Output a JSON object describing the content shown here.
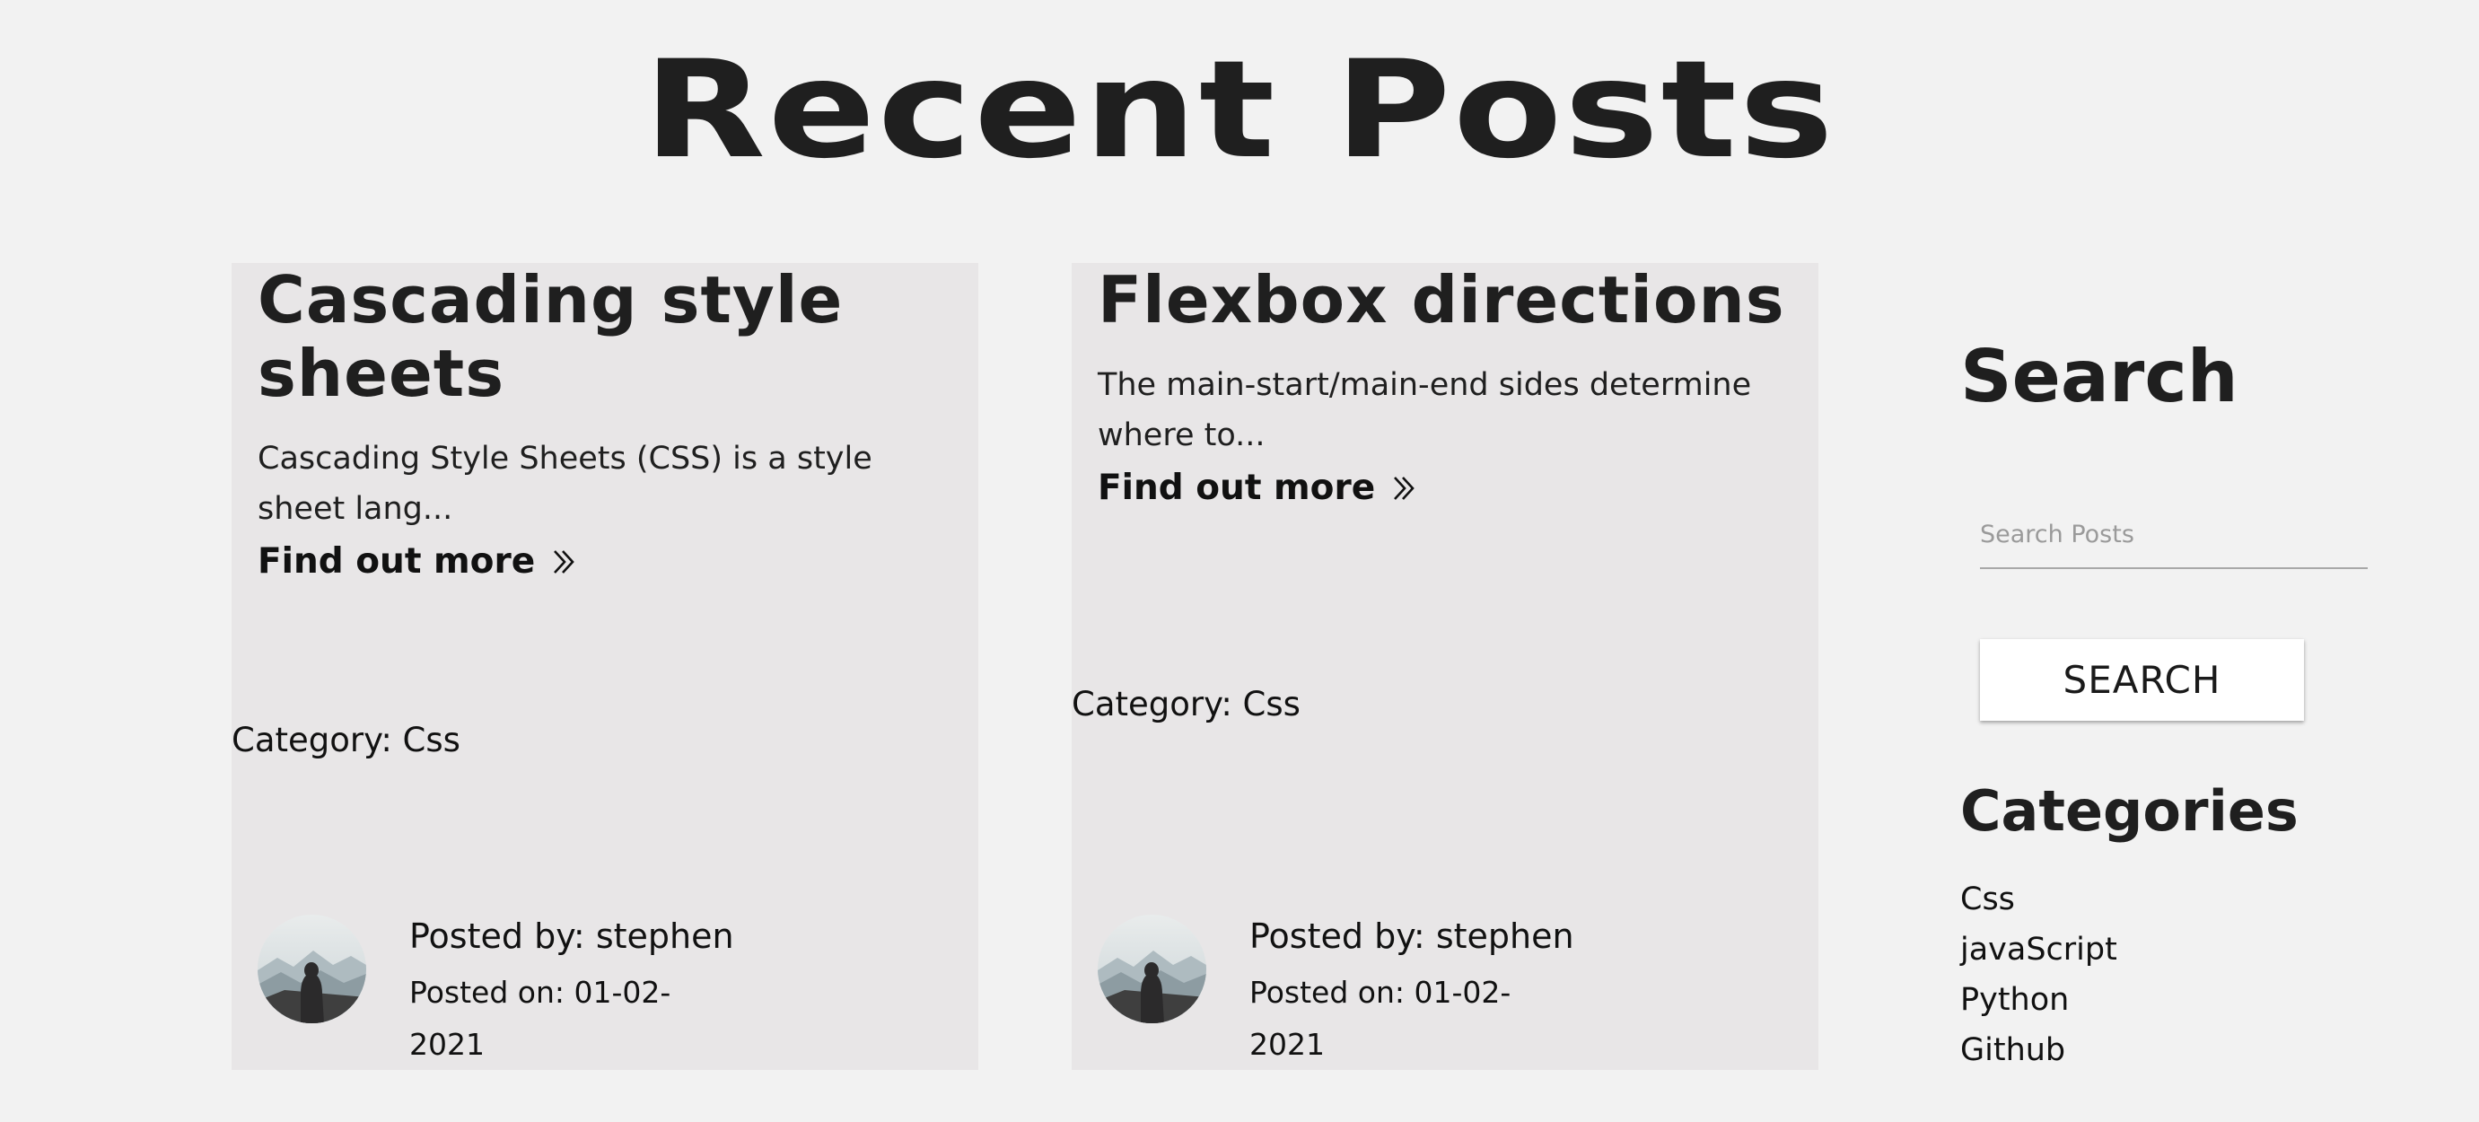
{
  "page": {
    "title": "Recent Posts"
  },
  "posts": [
    {
      "title": "Cascading style sheets",
      "excerpt": "Cascading Style Sheets (CSS) is a style sheet lang...",
      "link_label": "Find out more",
      "category": "Category: Css",
      "posted_by": "Posted by: stephen",
      "posted_on": "Posted on: 01-02-2021",
      "avatar_icon": "hooded-figure-mountains-avatar"
    },
    {
      "title": "Flexbox directions",
      "excerpt": "The main-start/main-end sides determine where to...",
      "link_label": "Find out more",
      "category": "Category: Css",
      "posted_by": "Posted by: stephen",
      "posted_on": "Posted on: 01-02-2021",
      "avatar_icon": "hooded-figure-mountains-avatar"
    }
  ],
  "sidebar": {
    "search_heading": "Search",
    "search_placeholder": "Search Posts",
    "search_value": "",
    "search_button_label": "SEARCH",
    "categories_heading": "Categories",
    "categories": [
      "Css",
      "javaScript",
      "Python",
      "Github"
    ]
  },
  "colors": {
    "background": "#f2f2f2",
    "card_background": "#e8e6e7",
    "text": "#1e1e1e",
    "button_background": "#ffffff"
  }
}
